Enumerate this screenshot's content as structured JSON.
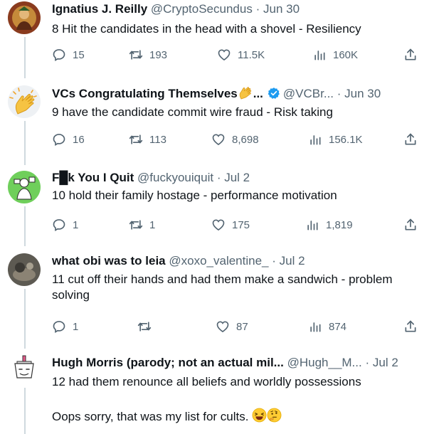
{
  "tweets": [
    {
      "name": "Ignatius J. Reilly",
      "handle": "@CryptoSecundus",
      "date": "Jun 30",
      "text": "8  Hit the candidates in the head with a shovel - Resiliency",
      "replies": "15",
      "retweets": "193",
      "likes": "11.5K",
      "views": "160K"
    },
    {
      "name": "VCs Congratulating Themselves",
      "name_suffix": "...",
      "handle": "@VCBr...",
      "date": "Jun 30",
      "text": "9 have the candidate commit wire fraud - Risk taking",
      "replies": "16",
      "retweets": "113",
      "likes": "8,698",
      "views": "156.1K"
    },
    {
      "name": "F█k You I Quit",
      "handle": "@fuckyouiquit",
      "date": "Jul 2",
      "text": "10 hold their family hostage - performance motivation",
      "replies": "1",
      "retweets": "1",
      "likes": "175",
      "views": "1,819"
    },
    {
      "name": "what obi was to leia",
      "handle": "@xoxo_valentine_",
      "date": "Jul 2",
      "text_line1": "11 cut off their hands and had them make a sandwich - problem",
      "text_line2": "solving",
      "replies": "1",
      "retweets": "",
      "likes": "87",
      "views": "874"
    },
    {
      "name": "Hugh Morris (parody; not an actual mil...",
      "handle": "@Hugh__M...",
      "date": "Jul 2",
      "text": "12 had them renounce all beliefs and worldly possessions",
      "text2": "Oops sorry, that was my list for cults."
    }
  ],
  "separator": "·",
  "icons": [
    "reply-icon",
    "retweet-icon",
    "like-icon",
    "views-icon",
    "share-icon",
    "verified-icon"
  ],
  "colors": {
    "text": "#0f1419",
    "secondary": "#536471",
    "verified": "#1d9bf0",
    "thread_line": "#cfd9de"
  }
}
